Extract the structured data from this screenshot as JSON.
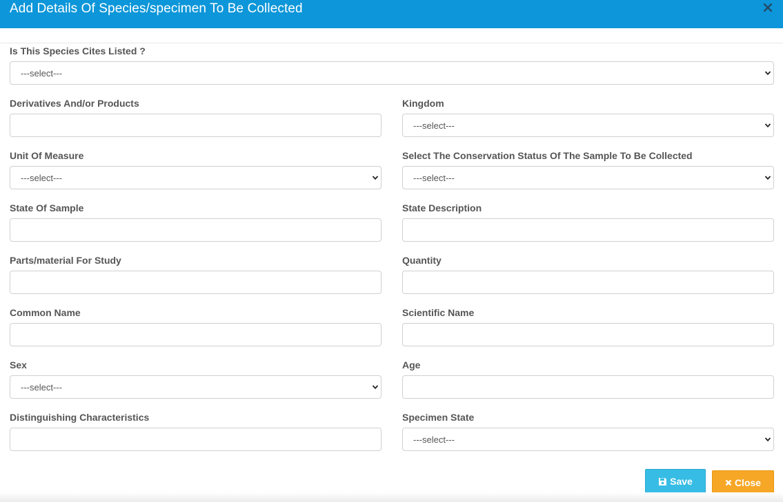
{
  "header": {
    "title": "Add Details Of Species/specimen To Be Collected",
    "close_glyph": "×"
  },
  "fields": {
    "cites": {
      "label": "Is This Species Cites Listed ?",
      "value": "---select---"
    },
    "derivatives": {
      "label": "Derivatives And/or Products",
      "value": ""
    },
    "kingdom": {
      "label": "Kingdom",
      "value": "---select---"
    },
    "unit": {
      "label": "Unit Of Measure",
      "value": "---select---"
    },
    "conservation": {
      "label": "Select The Conservation Status Of The Sample To Be Collected",
      "value": "---select---"
    },
    "state_sample": {
      "label": "State Of Sample",
      "value": ""
    },
    "state_desc": {
      "label": "State Description",
      "value": ""
    },
    "parts": {
      "label": "Parts/material For Study",
      "value": ""
    },
    "quantity": {
      "label": "Quantity",
      "value": ""
    },
    "common_name": {
      "label": "Common Name",
      "value": ""
    },
    "scientific_name": {
      "label": "Scientific Name",
      "value": ""
    },
    "sex": {
      "label": "Sex",
      "value": "---select---"
    },
    "age": {
      "label": "Age",
      "value": ""
    },
    "distinguishing": {
      "label": "Distinguishing Characteristics",
      "value": ""
    },
    "specimen_state": {
      "label": "Specimen State",
      "value": "---select---"
    }
  },
  "buttons": {
    "save_label": "Save",
    "close_label": "Close"
  },
  "icons": {
    "header_close": "close-icon",
    "save": "floppy-disk-icon",
    "close": "x-icon",
    "dropdown": "chevron-down-icon"
  },
  "colors": {
    "header_bg": "#0d96d9",
    "save_bg": "#37bde5",
    "close_bg": "#f7a726"
  }
}
